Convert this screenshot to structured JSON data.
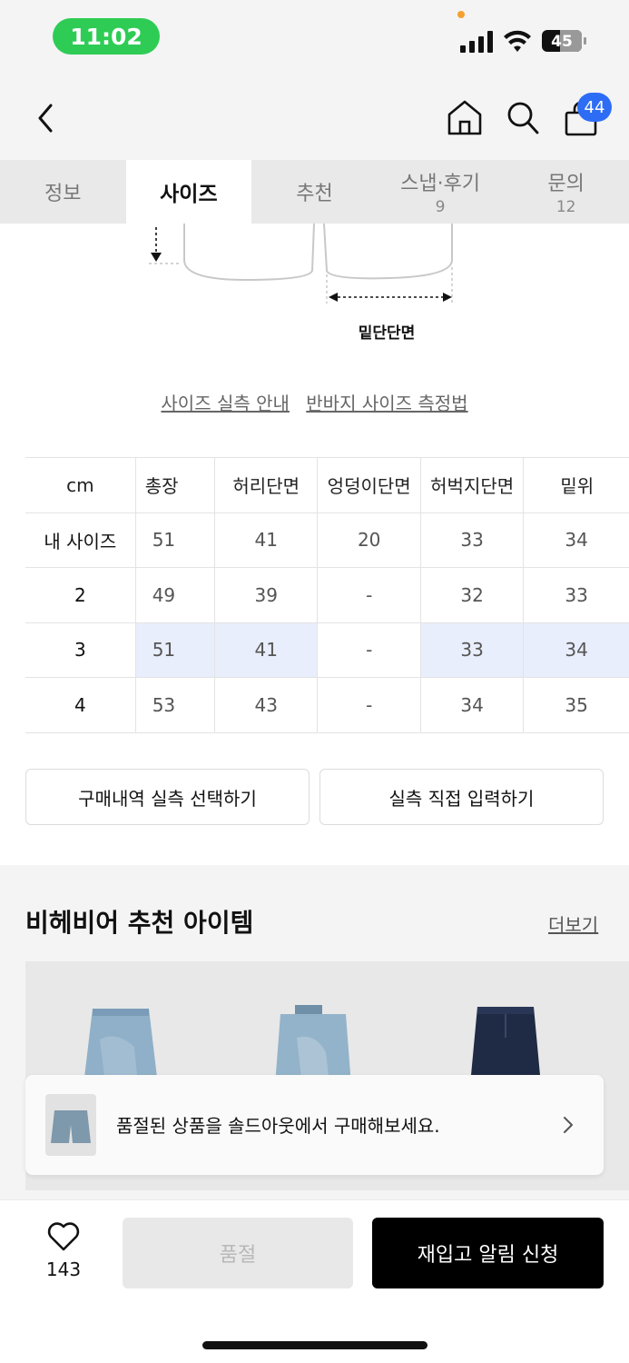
{
  "status_bar": {
    "time": "11:02",
    "battery_level": "45"
  },
  "header": {
    "cart_count": "44"
  },
  "tabs": [
    {
      "label": "정보",
      "count": ""
    },
    {
      "label": "사이즈",
      "count": ""
    },
    {
      "label": "추천",
      "count": ""
    },
    {
      "label": "스냅·후기",
      "count": "9"
    },
    {
      "label": "문의",
      "count": "12"
    }
  ],
  "active_tab": "사이즈",
  "diagram": {
    "label": "밑단단면"
  },
  "guide_links": {
    "measure_guide": "사이즈 실측 안내",
    "shorts_method": "반바지 사이즈 측정법"
  },
  "size_table": {
    "headers": [
      "cm",
      "총장",
      "허리단면",
      "엉덩이단면",
      "허벅지단면",
      "밑위"
    ],
    "rows": [
      {
        "label": "내 사이즈",
        "values": [
          "51",
          "41",
          "20",
          "33",
          "34"
        ]
      },
      {
        "label": "2",
        "values": [
          "49",
          "39",
          "-",
          "32",
          "33"
        ]
      },
      {
        "label": "3",
        "values": [
          "51",
          "41",
          "-",
          "33",
          "34"
        ]
      },
      {
        "label": "4",
        "values": [
          "53",
          "43",
          "-",
          "34",
          "35"
        ]
      }
    ]
  },
  "actions": {
    "purchase_history": "구매내역 실측 선택하기",
    "direct_input": "실측 직접 입력하기"
  },
  "recommend": {
    "title": "비헤비어 추천 아이템",
    "more": "더보기"
  },
  "toast": {
    "message": "품절된 상품을 솔드아웃에서 구매해보세요."
  },
  "bottom": {
    "like_count": "143",
    "soldout_label": "품절",
    "restock_label": "재입고 알림 신청"
  },
  "colors": {
    "badge": "#2d6df6",
    "highlight": "#e9eefc",
    "status_time_bg": "#2ecc55"
  }
}
